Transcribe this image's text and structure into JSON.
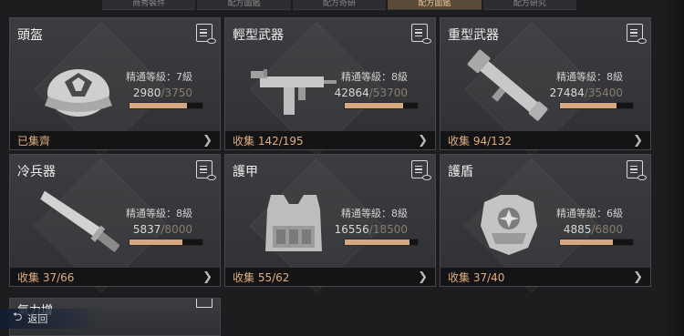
{
  "tabs": [
    {
      "label": "商秀裝件",
      "active": false
    },
    {
      "label": "配方圖鑑",
      "active": false
    },
    {
      "label": "配方奇研",
      "active": false
    },
    {
      "label": "配方圖鑑",
      "active": true
    },
    {
      "label": "配方研究",
      "active": false
    }
  ],
  "cards": [
    {
      "name": "頭盔",
      "level": "精通等級：7級",
      "current": "2980",
      "total": "/3750",
      "progress": 0.79,
      "footer": "已集齊",
      "art": "helmet-cap"
    },
    {
      "name": "輕型武器",
      "level": "精通等級：8級",
      "current": "42864",
      "total": "/53700",
      "progress": 0.8,
      "footer": "收集 142/195",
      "art": "smg"
    },
    {
      "name": "重型武器",
      "level": "精通等級：8級",
      "current": "27484",
      "total": "/35400",
      "progress": 0.78,
      "footer": "收集 94/132",
      "art": "launcher"
    },
    {
      "name": "冷兵器",
      "level": "精通等級：8級",
      "current": "5837",
      "total": "/8000",
      "progress": 0.73,
      "footer": "收集 37/66",
      "art": "machete"
    },
    {
      "name": "護甲",
      "level": "精通等級：8級",
      "current": "16556",
      "total": "/18500",
      "progress": 0.89,
      "footer": "收集 55/62",
      "art": "vest"
    },
    {
      "name": "護盾",
      "level": "精通等級：6級",
      "current": "4885",
      "total": "/6800",
      "progress": 0.72,
      "footer": "收集 37/40",
      "art": "shield-armor"
    }
  ],
  "partial_card_name": "氣力增",
  "back_label": "返回",
  "colors": {
    "accent": "#e0ad7e",
    "bar_fill": "#d5a882"
  }
}
